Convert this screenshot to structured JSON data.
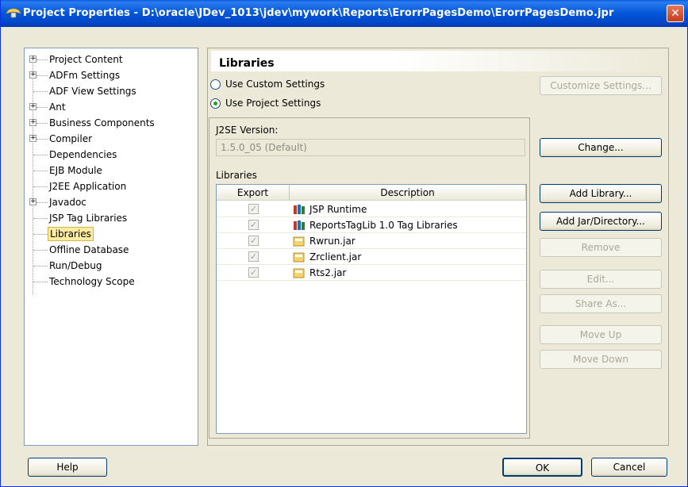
{
  "window": {
    "title": "Project Properties - D:\\oracle\\JDev_1013\\jdev\\mywork\\Reports\\ErorrPagesDemo\\ErorrPagesDemo.jpr",
    "close_glyph": "✕"
  },
  "tree": {
    "items": [
      {
        "label": "Project Content",
        "expandable": true
      },
      {
        "label": "ADFm Settings",
        "expandable": true
      },
      {
        "label": "ADF View Settings",
        "expandable": false
      },
      {
        "label": "Ant",
        "expandable": true
      },
      {
        "label": "Business Components",
        "expandable": true
      },
      {
        "label": "Compiler",
        "expandable": true
      },
      {
        "label": "Dependencies",
        "expandable": false
      },
      {
        "label": "EJB Module",
        "expandable": false
      },
      {
        "label": "J2EE Application",
        "expandable": false
      },
      {
        "label": "Javadoc",
        "expandable": true
      },
      {
        "label": "JSP Tag Libraries",
        "expandable": false
      },
      {
        "label": "Libraries",
        "expandable": false,
        "selected": true
      },
      {
        "label": "Offline Database",
        "expandable": false
      },
      {
        "label": "Run/Debug",
        "expandable": false
      },
      {
        "label": "Technology Scope",
        "expandable": false
      }
    ]
  },
  "panel": {
    "title": "Libraries",
    "radio_custom": "Use Custom Settings",
    "radio_project": "Use Project Settings",
    "selected_radio": "project",
    "j2se_label": "J2SE Version:",
    "j2se_value": "1.5.0_05 (Default)",
    "libraries_label": "Libraries"
  },
  "table": {
    "columns": [
      "Export",
      "Description"
    ],
    "rows": [
      {
        "checked": true,
        "description": "JSP Runtime",
        "icon": "library-icon"
      },
      {
        "checked": true,
        "description": "ReportsTagLib 1.0 Tag Libraries",
        "icon": "library-icon"
      },
      {
        "checked": true,
        "description": "Rwrun.jar",
        "icon": "jar-icon"
      },
      {
        "checked": true,
        "description": "Zrclient.jar",
        "icon": "jar-icon"
      },
      {
        "checked": true,
        "description": "Rts2.jar",
        "icon": "jar-icon"
      }
    ]
  },
  "buttons": {
    "customize": "Customize Settings...",
    "change": "Change...",
    "add_library": "Add Library...",
    "add_jar": "Add Jar/Directory...",
    "remove": "Remove",
    "edit": "Edit...",
    "share_as": "Share As...",
    "move_up": "Move Up",
    "move_down": "Move Down",
    "help": "Help",
    "ok": "OK",
    "cancel": "Cancel"
  },
  "colors": {
    "titlebar": "#0355d8",
    "selection": "#ffec9e",
    "window_bg": "#ece9d8"
  }
}
